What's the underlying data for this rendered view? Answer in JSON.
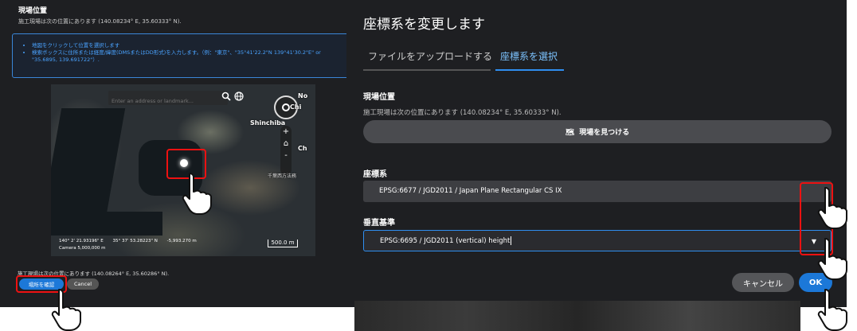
{
  "left": {
    "title": "現場位置",
    "subtitle": "施工現場は次の位置にあります (140.08234° E, 35.60333° N).",
    "instructions": [
      "地図をクリックして位置を選択します",
      "検索ボックスに住所または経度/緯度(DMSまたはDD形式)を入力します。（例：\"東京\"、\"35°41'22.2\"N 139°41'30.2\"E\" or \"35.6895, 139.691722\"）."
    ],
    "map": {
      "search_placeholder": "Enter an address or landmark...",
      "labels": {
        "a": "Shinchiba",
        "b": "千葉西方法務",
        "c": "Chi",
        "d": "No",
        "e": "Ch"
      },
      "readout": {
        "lon": "140° 2' 21.93196\" E",
        "lat": "35° 37' 53.28223\" N",
        "height": "-5,993.270 m",
        "camera": "Camera 5,000,000 m"
      },
      "scale": "500.0 m",
      "icons": {
        "search": "search-icon",
        "globe": "globe-icon",
        "home": "home-icon",
        "zoom_in": "+",
        "zoom_out": "-"
      }
    },
    "status": "施工現場は次の位置にあります (140.08264° E, 35.60286° N).",
    "confirm_label": "場所を確認",
    "cancel_label": "Cancel"
  },
  "right": {
    "heading": "座標系を変更します",
    "tabs": [
      {
        "label": "ファイルをアップロードする",
        "active": false
      },
      {
        "label": "座標系を選択",
        "active": true
      }
    ],
    "site": {
      "title": "現場位置",
      "subtitle": "施工現場は次の位置にあります (140.08234° E, 35.60333° N).",
      "find_label": "現場を見つける"
    },
    "crs": {
      "label": "座標系",
      "value": "EPSG:6677 / JGD2011 / Japan Plane Rectangular CS IX"
    },
    "vertical": {
      "label": "垂直基準",
      "value": "EPSG:6695 / JGD2011 (vertical) height"
    },
    "cancel_label": "キャンセル",
    "ok_label": "OK"
  },
  "colors": {
    "panel_bg": "#1e1f22",
    "accent_blue": "#1c78d8",
    "highlight_red": "#e11111"
  }
}
